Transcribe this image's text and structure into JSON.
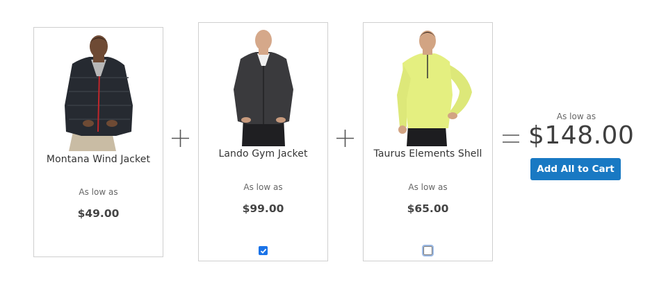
{
  "products": [
    {
      "name": "Montana Wind Jacket",
      "as_low_as": "As low as",
      "price": "$49.00",
      "image": "man-in-black-quilted-jacket-photo",
      "checkbox": null
    },
    {
      "name": "Lando Gym Jacket",
      "as_low_as": "As low as",
      "price": "$99.00",
      "image": "man-in-charcoal-fleece-jacket-photo",
      "checkbox": "checked"
    },
    {
      "name": "Taurus Elements Shell",
      "as_low_as": "As low as",
      "price": "$65.00",
      "image": "man-in-yellow-pullover-photo",
      "checkbox": "unchecked"
    }
  ],
  "operators": {
    "plus": "plus-icon",
    "equals": "equals-icon"
  },
  "total": {
    "as_low_as": "As low as",
    "price": "$148.00"
  },
  "add_all_button": {
    "label": "Add All to Cart"
  },
  "colors": {
    "button": "#1979c3",
    "border": "#cfcfcf",
    "checkbox": "#1a73e8",
    "text": "#333333"
  }
}
